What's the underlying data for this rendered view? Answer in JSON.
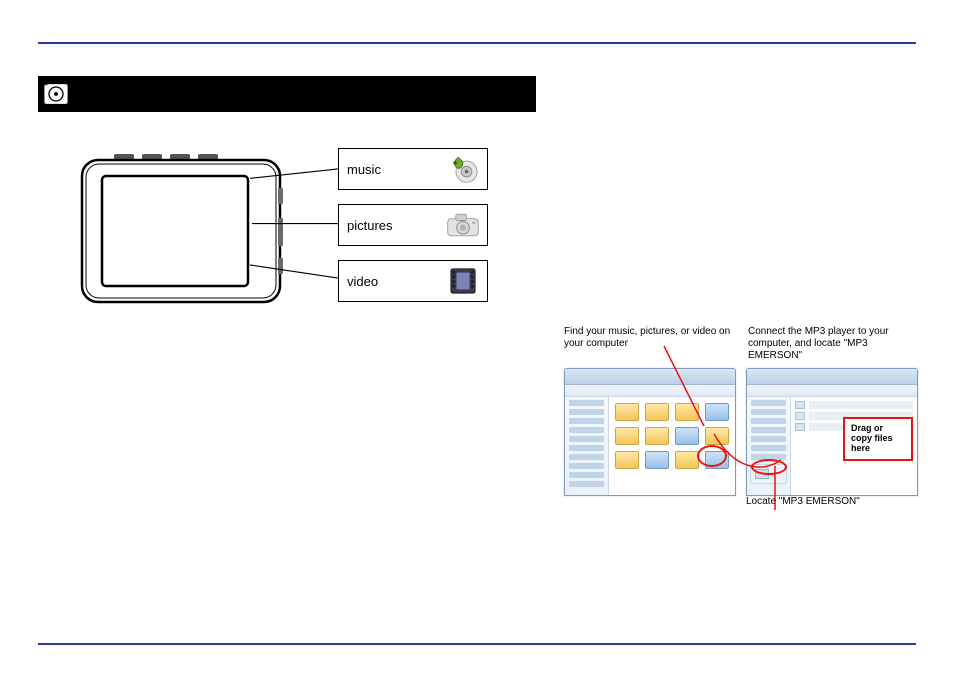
{
  "section_title": "",
  "menu": {
    "music": "music",
    "pictures": "pictures",
    "video": "video"
  },
  "instructions": {
    "left": "Find your music, pictures, or video on your computer",
    "right": "Connect the MP3 player to your computer, and locate \"MP3 EMERSON\"",
    "callout": "Drag or copy files here",
    "locate": "Locate \"MP3 EMERSON\""
  }
}
